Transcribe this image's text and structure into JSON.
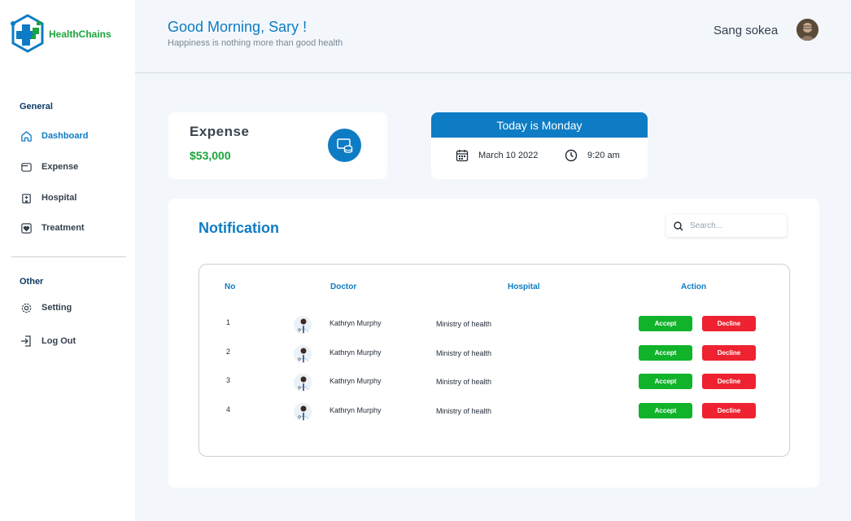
{
  "app": {
    "name": "HealthChains",
    "brand_green": "#1aa53c",
    "brand_blue": "#0e7cc4"
  },
  "sidebar": {
    "general_title": "General",
    "items": [
      {
        "label": "Dashboard",
        "icon": "home-icon",
        "active": true
      },
      {
        "label": "Expense",
        "icon": "wallet-icon",
        "active": false
      },
      {
        "label": "Hospital",
        "icon": "hospital-icon",
        "active": false
      },
      {
        "label": "Treatment",
        "icon": "heart-monitor-icon",
        "active": false
      }
    ],
    "other_title": "Other",
    "other_items": [
      {
        "label": "Setting",
        "icon": "gear-icon"
      },
      {
        "label": "Log Out",
        "icon": "logout-icon"
      }
    ]
  },
  "header": {
    "greeting": "Good Morning, Sary !",
    "subtitle": "Happiness is nothing more than  good health",
    "username": "Sang sokea"
  },
  "expense": {
    "title": "Expense",
    "value": "$53,000",
    "icon": "database-icon"
  },
  "today": {
    "title": "Today is Monday",
    "date": "March 10 2022",
    "time": "9:20 am"
  },
  "notification": {
    "title": "Notification",
    "search_placeholder": "Search...",
    "columns": {
      "no": "No",
      "doctor": "Doctor",
      "hospital": "Hospital",
      "action": "Action"
    },
    "rows": [
      {
        "no": "1",
        "doctor": "Kathryn Murphy",
        "hospital": "Ministry of health",
        "accept": "Accept",
        "decline": "Decline"
      },
      {
        "no": "2",
        "doctor": "Kathryn Murphy",
        "hospital": "Ministry of health",
        "accept": "Accept",
        "decline": "Decline"
      },
      {
        "no": "3",
        "doctor": "Kathryn Murphy",
        "hospital": "Ministry of health",
        "accept": "Accept",
        "decline": "Decline"
      },
      {
        "no": "4",
        "doctor": "Kathryn Murphy",
        "hospital": "Ministry of health",
        "accept": "Accept",
        "decline": "Decline"
      }
    ]
  }
}
